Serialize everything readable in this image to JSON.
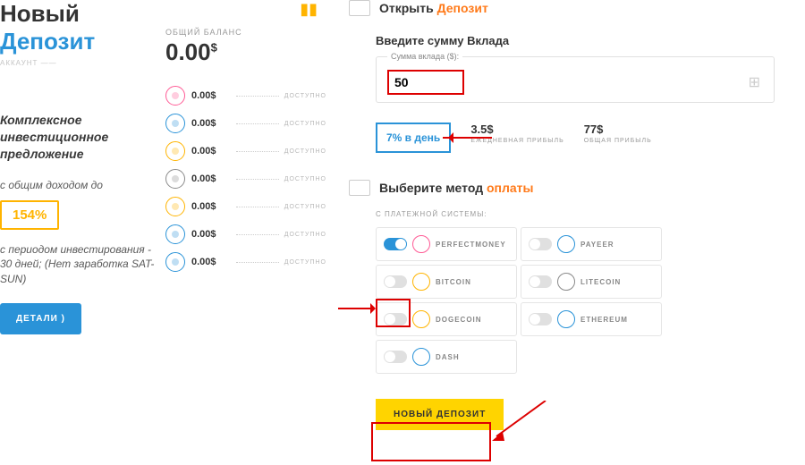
{
  "left": {
    "title1": "Новый",
    "title2": "Депозит",
    "account_label": "АККАУНТ ——",
    "offer": "Комплексное инвестиционное предложение",
    "income_label": "с общим доходом до",
    "percent": "154%",
    "period": "с периодом инвестирования - 30 дней; (Нет заработка SAT-SUN)",
    "details_btn": "ДЕТАЛИ  )"
  },
  "balance": {
    "label": "ОБЩИЙ БАЛАНС",
    "value": "0.00",
    "currency": "$",
    "coins": [
      {
        "color": "#ff5a95",
        "amt": "0.00$"
      },
      {
        "color": "#2a93d8",
        "amt": "0.00$"
      },
      {
        "color": "#ffb400",
        "amt": "0.00$"
      },
      {
        "color": "#8a8a8a",
        "amt": "0.00$"
      },
      {
        "color": "#ffb400",
        "amt": "0.00$"
      },
      {
        "color": "#2a93d8",
        "amt": "0.00$"
      },
      {
        "color": "#2a93d8",
        "amt": "0.00$"
      }
    ],
    "available": "ДОСТУПНО"
  },
  "main": {
    "open_deposit_prefix": "Открыть ",
    "open_deposit_hl": "Депозит",
    "enter_amount": "Введите сумму Вклада",
    "input_legend": "Сумма вклада ($):",
    "amount_value": "50",
    "rate": "7% в день",
    "daily_val": "3.5$",
    "daily_lbl": "ЕЖЕДНЕВНАЯ ПРИБЫЛЬ",
    "total_val": "77$",
    "total_lbl": "ОБЩАЯ ПРИБЫЛЬ",
    "choose_prefix": "Выберите метод ",
    "choose_hl": "оплаты",
    "system_label": "С ПЛАТЕЖНОЙ СИСТЕМЫ:",
    "methods": [
      {
        "name": "PERFECTMONEY",
        "on": true,
        "color": "#ff5a95"
      },
      {
        "name": "PAYEER",
        "on": false,
        "color": "#2a93d8"
      },
      {
        "name": "BITCOIN",
        "on": false,
        "color": "#ffb400"
      },
      {
        "name": "LITECOIN",
        "on": false,
        "color": "#8a8a8a"
      },
      {
        "name": "DOGECOIN",
        "on": false,
        "color": "#ffb400"
      },
      {
        "name": "ETHEREUM",
        "on": false,
        "color": "#2a93d8"
      },
      {
        "name": "DASH",
        "on": false,
        "color": "#2a93d8"
      }
    ],
    "submit": "НОВЫЙ ДЕПОЗИТ"
  }
}
